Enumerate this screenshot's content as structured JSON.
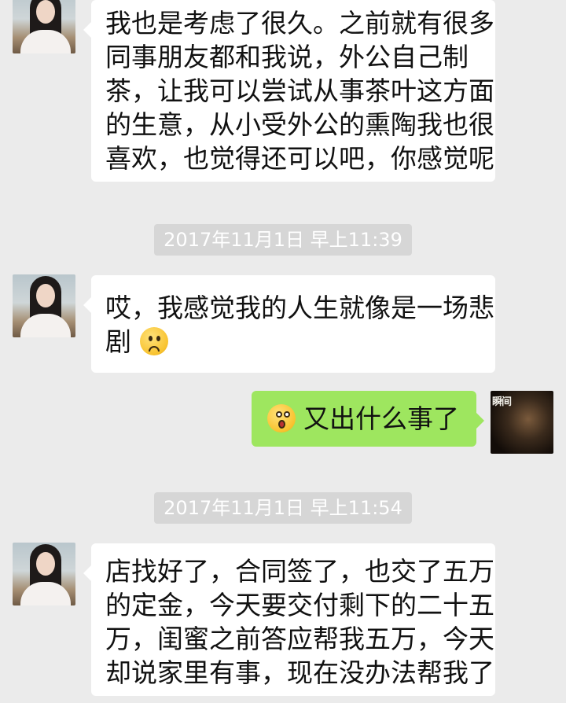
{
  "messages": [
    {
      "side": "left",
      "lines": [
        "我也是考虑了很久。之前就有很多",
        "同事朋友都和我说，外公自己制",
        "茶，让我可以尝试从事茶叶这方面",
        "的生意，从小受外公的熏陶我也很",
        "喜欢，也觉得还可以吧，你感觉呢"
      ]
    },
    {
      "timestamp": "2017年11月1日 早上11:39"
    },
    {
      "side": "left",
      "lines": [
        "哎，我感觉我的人生就像是一场悲",
        "剧"
      ],
      "emoji": "sad-face-icon"
    },
    {
      "side": "right",
      "emoji": "shocked-face-icon",
      "text": "又出什么事了",
      "avatar_text": "瞬间"
    },
    {
      "timestamp": "2017年11月1日 早上11:54"
    },
    {
      "side": "left",
      "lines": [
        "店找好了，合同签了，也交了五万",
        "的定金，今天要交付剩下的二十五",
        "万，闺蜜之前答应帮我五万，今天",
        "却说家里有事，现在没办法帮我了"
      ]
    }
  ],
  "colors": {
    "background": "#ebebeb",
    "incoming_bubble": "#ffffff",
    "outgoing_bubble": "#9ee65f",
    "timestamp_bg": "#d6d6d6"
  }
}
